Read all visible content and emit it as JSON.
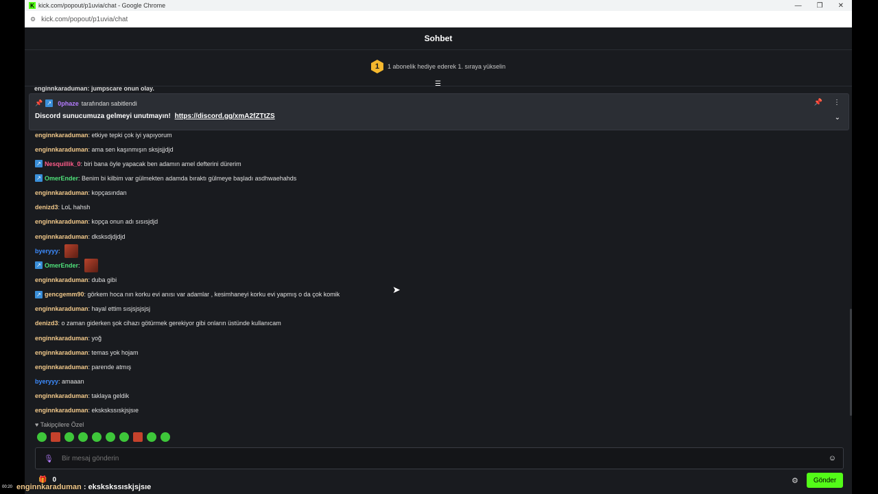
{
  "window": {
    "title": "kick.com/popout/p1uvia/chat - Google Chrome",
    "url": "kick.com/popout/p1uvia/chat",
    "controls": [
      "—",
      "❐",
      "✕"
    ]
  },
  "header": {
    "title": "Sohbet"
  },
  "gift": {
    "rank": "1",
    "text": "1 abonelik hediye ederek 1. sıraya yükselin"
  },
  "partial_message": "enginnkaraduman: jumpscare onun olay.",
  "pinned": {
    "author": "0phaze",
    "by_text": "tarafından sabitlendi",
    "message": "Discord sunucumuza gelmeyi unutmayın!",
    "link": "https://discord.gg/xmA2fZTtZS"
  },
  "messages": [
    {
      "user": "enginnkaraduman",
      "color": "#f2c98b",
      "badge": false,
      "text": "etkiye tepki çok iyi yapıyorum"
    },
    {
      "user": "enginnkaraduman",
      "color": "#f2c98b",
      "badge": false,
      "text": "ama sen kaşınmışın sksjsjjdjd"
    },
    {
      "user": "Nesquillik_0",
      "color": "#ff5c8a",
      "badge": true,
      "text": "biri bana öyle yapacak ben adamın amel defterini dürerim"
    },
    {
      "user": "OmerEnder",
      "color": "#4fe07a",
      "badge": true,
      "text": "Benim bi kilbim var gülmekten adamda bıraktı gülmeye başladı asdhwaehahds"
    },
    {
      "user": "enginnkaraduman",
      "color": "#f2c98b",
      "badge": false,
      "text": "kopçasından"
    },
    {
      "user": "denizd3",
      "color": "#f2c98b",
      "badge": false,
      "text": "LoL hahsh"
    },
    {
      "user": "enginnkaraduman",
      "color": "#f2c98b",
      "badge": false,
      "text": "kopça onun adı sısısjdjd"
    },
    {
      "user": "enginnkaraduman",
      "color": "#f2c98b",
      "badge": false,
      "text": "dksksdjdjdjd"
    },
    {
      "user": "byeryyy",
      "color": "#3d8cff",
      "badge": false,
      "text": "",
      "emote": true
    },
    {
      "user": "OmerEnder",
      "color": "#4fe07a",
      "badge": true,
      "text": "",
      "emote": true
    },
    {
      "user": "enginnkaraduman",
      "color": "#f2c98b",
      "badge": false,
      "text": "duba gibi"
    },
    {
      "user": "gencgemm90",
      "color": "#f2c98b",
      "badge": true,
      "text": "görkem hoca nın korku evi anısı var adamlar , kesimhaneyi korku evi yapmış o da çok komik"
    },
    {
      "user": "enginnkaraduman",
      "color": "#f2c98b",
      "badge": false,
      "text": "hayal ettim sısjsjsjsjsj"
    },
    {
      "user": "denizd3",
      "color": "#f2c98b",
      "badge": false,
      "text": "o zaman giderken şok cihazı götürmek gerekiyor gibi onların üstünde kullanıcam"
    },
    {
      "user": "enginnkaraduman",
      "color": "#f2c98b",
      "badge": false,
      "text": "yoğ"
    },
    {
      "user": "enginnkaraduman",
      "color": "#f2c98b",
      "badge": false,
      "text": "temas yok hojam"
    },
    {
      "user": "enginnkaraduman",
      "color": "#f2c98b",
      "badge": false,
      "text": "parende atmış"
    },
    {
      "user": "byeryyy",
      "color": "#3d8cff",
      "badge": false,
      "text": "amaaan"
    },
    {
      "user": "enginnkaraduman",
      "color": "#f2c98b",
      "badge": false,
      "text": "taklaya geldik"
    },
    {
      "user": "enginnkaraduman",
      "color": "#f2c98b",
      "badge": false,
      "text": "ekskskssıskjsjsıe"
    }
  ],
  "followers_label": "Takipçilere Özel",
  "input": {
    "placeholder": "Bir mesaj gönderin"
  },
  "bottom": {
    "gift_count": "0",
    "send_label": "Gönder"
  },
  "overlay": {
    "time": "00:20",
    "user": "enginnkaraduman",
    "text": ": ekskskssıskjsjsıe"
  }
}
